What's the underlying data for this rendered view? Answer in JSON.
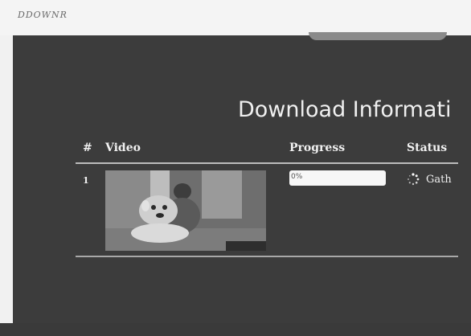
{
  "app": {
    "brand": "DDOWNR"
  },
  "page": {
    "title": "Download Informati"
  },
  "table": {
    "columns": [
      "#",
      "Video",
      "Progress",
      "Status"
    ],
    "rows": [
      {
        "index": "1",
        "thumbnail": "video-thumbnail",
        "progress": 0,
        "progress_text": "0%",
        "status": "Gath"
      }
    ]
  },
  "icons": {
    "status": "loading-spinner-icon"
  }
}
